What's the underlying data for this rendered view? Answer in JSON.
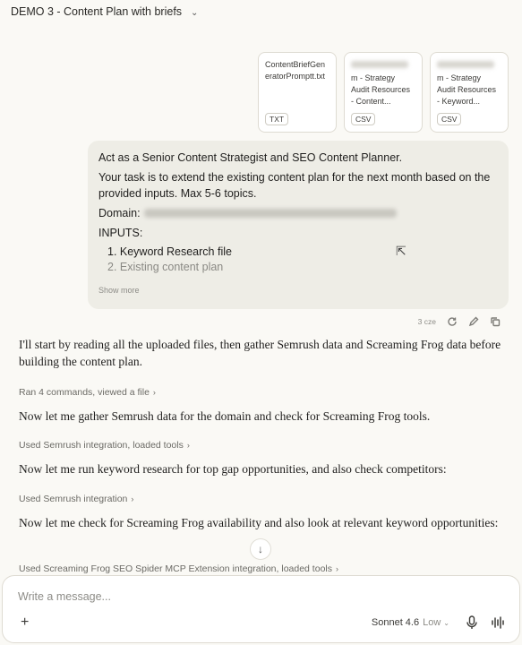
{
  "header": {
    "title": "DEMO 3 - Content Plan with briefs"
  },
  "files": [
    {
      "name": "ContentBriefGeneratorPromptt.txt",
      "type": "TXT",
      "blurred": false
    },
    {
      "name_lines": [
        "m - Strategy",
        "Audit Resources",
        "- Content..."
      ],
      "type": "CSV",
      "blurred": true
    },
    {
      "name_lines": [
        "m - Strategy",
        "Audit Resources",
        "- Keyword..."
      ],
      "type": "CSV",
      "blurred": true
    }
  ],
  "user_message": {
    "line1": "Act as a Senior Content Strategist and SEO Content Planner.",
    "line2": "Your task is to extend the existing content plan for the next month based on the provided inputs. Max 5-6 topics.",
    "domain_label": "Domain:",
    "inputs_label": "INPUTS:",
    "items": [
      "1. Keyword Research file",
      "2. Existing content plan"
    ],
    "show_more": "Show more"
  },
  "message_actions": {
    "time": "3 cze"
  },
  "assistant": {
    "m1": "I'll start by reading all the uploaded files, then gather Semrush data and Screaming Frog data before building the content plan.",
    "t1": "Ran 4 commands, viewed a file",
    "m2": "Now let me gather Semrush data for the domain and check for Screaming Frog tools.",
    "t2": "Used Semrush integration, loaded tools",
    "m3": "Now let me run keyword research for top gap opportunities, and also check competitors:",
    "t3": "Used Semrush integration",
    "m4": "Now let me check for Screaming Frog availability and also look at relevant keyword opportunities:",
    "t4": "Used Screaming Frog SEO Spider MCP Extension integration, loaded tools"
  },
  "composer": {
    "placeholder": "Write a message...",
    "model": "Sonnet 4.6",
    "effort": "Low"
  }
}
